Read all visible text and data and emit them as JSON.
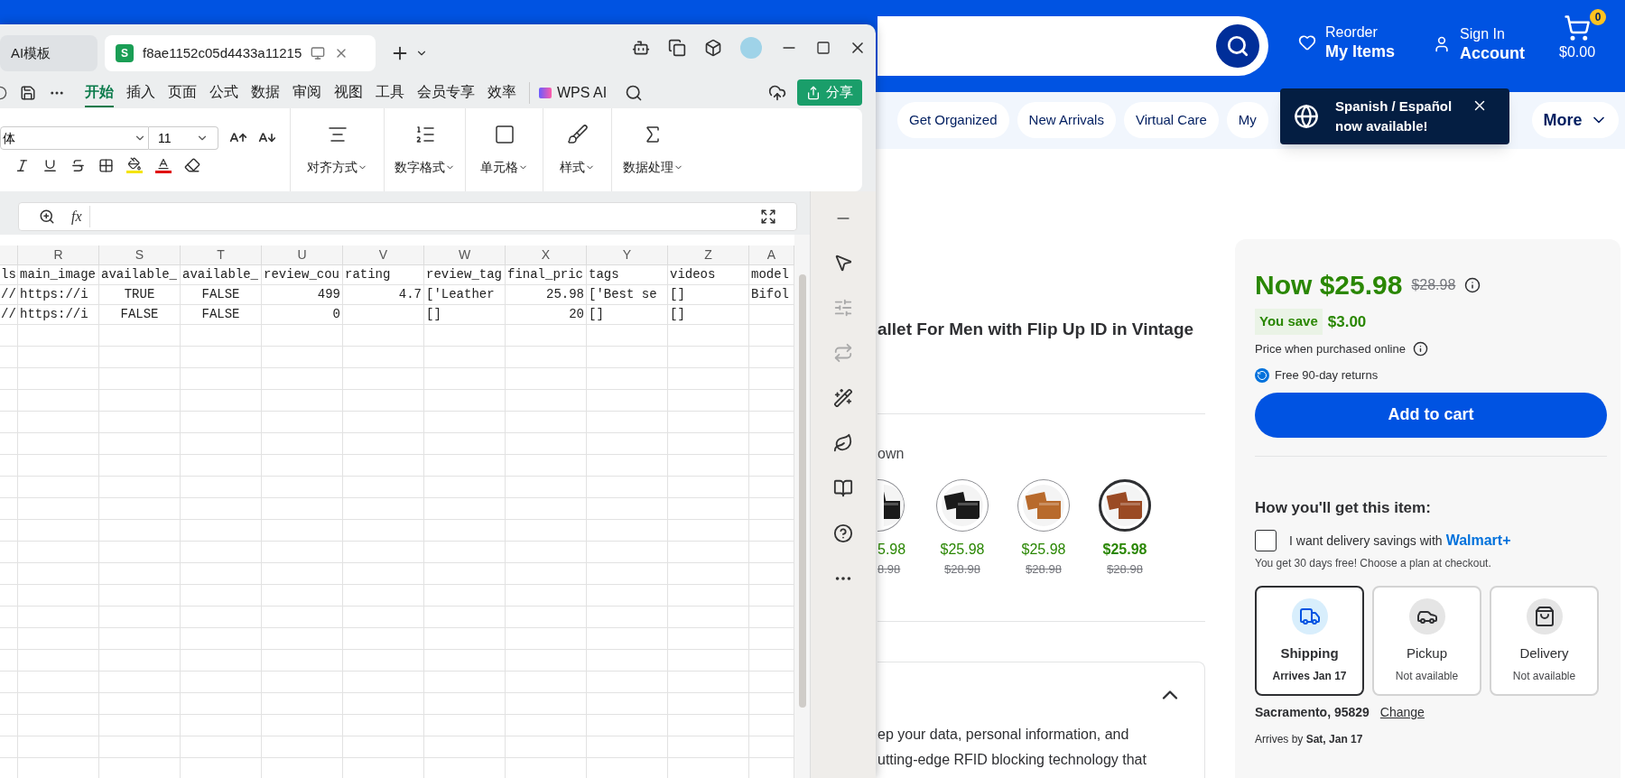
{
  "browser_page": {
    "header": {
      "reorder": {
        "top": "Reorder",
        "bottom": "My Items"
      },
      "account": {
        "top": "Sign In",
        "bottom": "Account"
      },
      "cart": {
        "count": "0",
        "total": "$0.00"
      }
    },
    "categories": [
      {
        "label": "Get Organized"
      },
      {
        "label": "New Arrivals"
      },
      {
        "label": "Virtual Care"
      },
      {
        "label": "My"
      }
    ],
    "more_button": "More",
    "tooltip": {
      "line1": "Spanish / Español",
      "line2": "now available!"
    },
    "product": {
      "title": "allet For Men with Flip Up ID in Vintage",
      "color_label": "own",
      "swatches": [
        {
          "price": "5.98",
          "was": "8.98",
          "selected": false
        },
        {
          "price": "$25.98",
          "was": "$28.98",
          "selected": false
        },
        {
          "price": "$25.98",
          "was": "$28.98",
          "selected": false
        },
        {
          "price": "$25.98",
          "was": "$28.98",
          "selected": true
        }
      ],
      "description": {
        "line1": "ep your data, personal information, and",
        "line2": "utting-edge RFID blocking technology that"
      }
    },
    "buy_box": {
      "now": "Now $25.98",
      "was": "$28.98",
      "you_save": "You save",
      "save_amount": "$3.00",
      "price_note": "Price when purchased online",
      "returns": "Free 90-day returns",
      "add_to_cart": "Add to cart",
      "how_title": "How you'll get this item:",
      "savings": {
        "label": "I want delivery savings with",
        "brand": "Walmart+",
        "checked": false,
        "note": "You get 30 days free! Choose a plan at checkout."
      },
      "options": [
        {
          "kind": "truck",
          "name": "Shipping",
          "detail": "Arrives Jan 17",
          "selected": true
        },
        {
          "kind": "car",
          "name": "Pickup",
          "detail": "Not available",
          "selected": false
        },
        {
          "kind": "bag",
          "name": "Delivery",
          "detail": "Not available",
          "selected": false
        }
      ],
      "location": "Sacramento, 95829",
      "change": "Change",
      "arrives_prefix": "Arrives by",
      "arrives_date": "Sat, Jan 17"
    }
  },
  "spreadsheet_window": {
    "tabs": [
      {
        "title": "AI模板",
        "selected": false
      },
      {
        "title": "f8ae1152c05d4433a11215",
        "selected": true
      }
    ],
    "menu": [
      {
        "label": "开始",
        "selected": true
      },
      {
        "label": "插入",
        "selected": false
      },
      {
        "label": "页面",
        "selected": false
      },
      {
        "label": "公式",
        "selected": false
      },
      {
        "label": "数据",
        "selected": false
      },
      {
        "label": "审阅",
        "selected": false
      },
      {
        "label": "视图",
        "selected": false
      },
      {
        "label": "工具",
        "selected": false
      },
      {
        "label": "会员专享",
        "selected": false
      },
      {
        "label": "效率",
        "selected": false
      }
    ],
    "app_icon": "S",
    "ai_button": "WPS AI",
    "share_button": "分享",
    "ribbon": {
      "font": "体",
      "size": "11",
      "groups": [
        "对齐方式",
        "数字格式",
        "单元格",
        "样式",
        "数据处理"
      ]
    },
    "formula_label": "fx",
    "columns": [
      "",
      "R",
      "S",
      "T",
      "U",
      "V",
      "W",
      "X",
      "Y",
      "Z",
      "A"
    ],
    "rows": [
      [
        {
          "v": "ls",
          "kind": "text"
        },
        {
          "v": "main_image",
          "kind": "text"
        },
        {
          "v": "available_",
          "kind": "text"
        },
        {
          "v": "available_",
          "kind": "text"
        },
        {
          "v": "review_cou",
          "kind": "text"
        },
        {
          "v": "rating",
          "kind": "text"
        },
        {
          "v": "review_tag",
          "kind": "text"
        },
        {
          "v": "final_pric",
          "kind": "text"
        },
        {
          "v": "tags",
          "kind": "text"
        },
        {
          "v": "videos",
          "kind": "text"
        },
        {
          "v": "model",
          "kind": "text"
        }
      ],
      [
        {
          "v": "//",
          "kind": "text"
        },
        {
          "v": "https://i",
          "kind": "text"
        },
        {
          "v": "TRUE",
          "kind": "bool"
        },
        {
          "v": "FALSE",
          "kind": "bool"
        },
        {
          "v": "499",
          "kind": "number"
        },
        {
          "v": "4.7",
          "kind": "number"
        },
        {
          "v": "['Leather",
          "kind": "text"
        },
        {
          "v": "25.98",
          "kind": "number"
        },
        {
          "v": "['Best se",
          "kind": "text"
        },
        {
          "v": "[]",
          "kind": "text"
        },
        {
          "v": "Bifol",
          "kind": "text"
        }
      ],
      [
        {
          "v": "//",
          "kind": "text"
        },
        {
          "v": "https://i",
          "kind": "text"
        },
        {
          "v": "FALSE",
          "kind": "bool"
        },
        {
          "v": "FALSE",
          "kind": "bool"
        },
        {
          "v": "0",
          "kind": "number"
        },
        null,
        {
          "v": "[]",
          "kind": "text"
        },
        {
          "v": "20",
          "kind": "number"
        },
        {
          "v": "[]",
          "kind": "text"
        },
        {
          "v": "[]",
          "kind": "text"
        },
        null
      ]
    ]
  }
}
